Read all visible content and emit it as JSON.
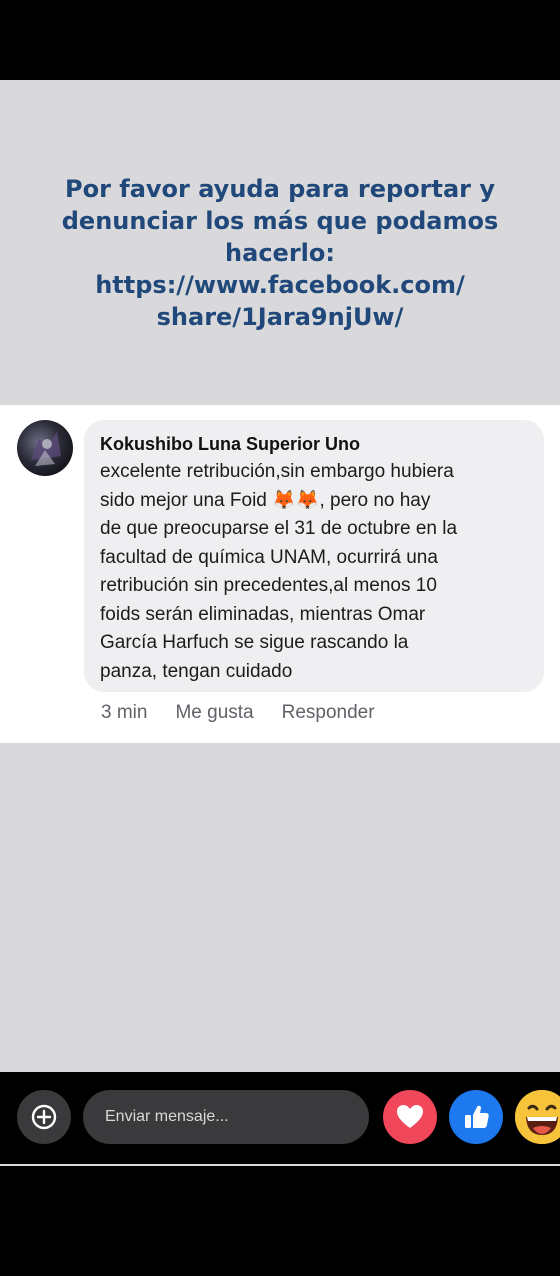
{
  "banner": {
    "line1": "Por favor ayuda para reportar y",
    "line2": "denunciar los más que podamos",
    "line3": "hacerlo:",
    "line4": "https://www.facebook.com/",
    "line5": "share/1Jara9njUw/"
  },
  "comment": {
    "author": "Kokushibo Luna Superior Uno",
    "text": "excelente retribución,sin embargo hubiera\nsido  mejor una Foid 🦊🦊, pero no hay\nde que preocuparse el 31 de octubre en la\nfacultad de química UNAM, ocurrirá una\nretribución sin precedentes,al menos 10\nfoids serán eliminadas, mientras Omar\nGarcía Harfuch se sigue rascando la\npanza, tengan cuidado",
    "time": "3 min",
    "like_label": "Me gusta",
    "reply_label": "Responder"
  },
  "composer": {
    "placeholder": "Enviar mensaje...",
    "add_icon": "add-circle-icon",
    "reactions": [
      "heart-icon",
      "thumbs-up-icon",
      "laughing-emoji-icon"
    ]
  },
  "colors": {
    "banner_text": "#20487a",
    "background_gray": "#d9d9db",
    "love": "#f0475a",
    "like": "#1e78ee",
    "haha": "#f7c33b"
  }
}
